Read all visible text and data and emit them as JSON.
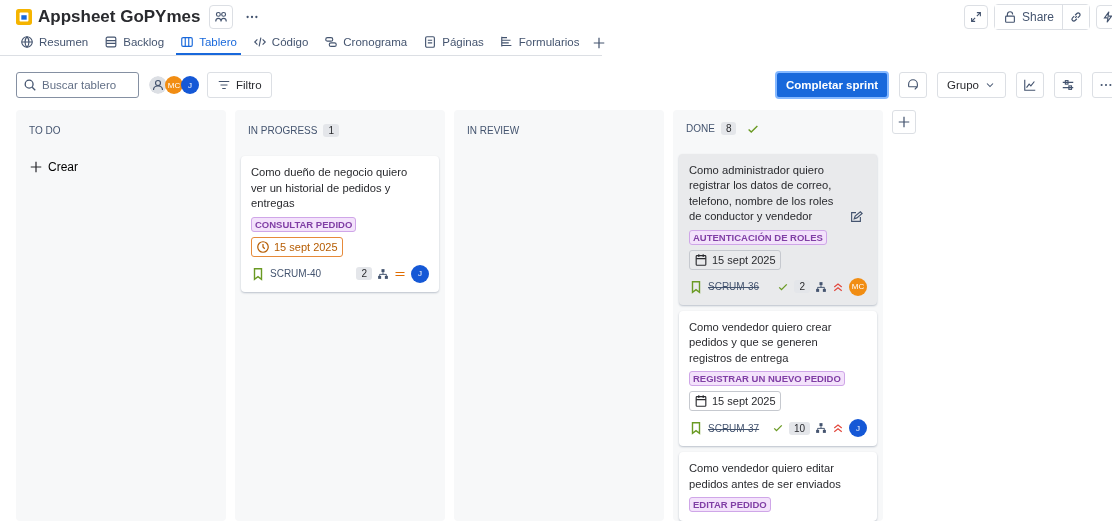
{
  "project": {
    "title": "Appsheet GoPYmes"
  },
  "header_actions": {
    "share": "Share"
  },
  "tabs": [
    {
      "label": "Resumen",
      "selected": false
    },
    {
      "label": "Backlog",
      "selected": false
    },
    {
      "label": "Tablero",
      "selected": true
    },
    {
      "label": "Código",
      "selected": false
    },
    {
      "label": "Cronograma",
      "selected": false
    },
    {
      "label": "Páginas",
      "selected": false
    },
    {
      "label": "Formularios",
      "selected": false
    }
  ],
  "toolbar": {
    "search": {
      "placeholder": "Buscar tablero"
    },
    "avatars": [
      {
        "kind": "unassigned"
      },
      {
        "kind": "person",
        "initials": "MC",
        "color": "#f18d13"
      },
      {
        "kind": "person",
        "initials": "J",
        "color": "#1558d6"
      }
    ],
    "filter": "Filtro",
    "primary": "Completar sprint",
    "group": "Grupo"
  },
  "columns": [
    {
      "title": "TO DO",
      "create": "Crear"
    },
    {
      "title": "IN PROGRESS",
      "count": "1",
      "cards": [
        {
          "text": "Como dueño de negocio quiero ver un historial de pedidos y entregas",
          "selected": false,
          "label": "CONSULTAR PEDIDO",
          "date": {
            "kind": "due",
            "text": "15 sept 2025"
          },
          "key": "SCRUM-40",
          "done": false,
          "points": "2",
          "priority": {
            "kind": "medium"
          },
          "avatar": {
            "initials": "J",
            "color": "#1558d6"
          }
        }
      ]
    },
    {
      "title": "IN REVIEW"
    },
    {
      "title": "DONE",
      "count": "8",
      "complete": true,
      "cards": [
        {
          "text": "Como administrador quiero registrar los datos de correo, telefono, nombre de los roles de conductor y vendedor",
          "selected": true,
          "label": "AUTENTICACIÓN DE ROLES",
          "date": {
            "kind": "date",
            "text": "15 sept 2025"
          },
          "key": "SCRUM-36",
          "done": true,
          "points": "2",
          "priority": {
            "kind": "high"
          },
          "avatar": {
            "initials": "MC",
            "color": "#f18d13"
          }
        },
        {
          "text": "Como vendedor quiero crear pedidos y que se generen registros de entrega",
          "selected": false,
          "label": "REGISTRAR UN NUEVO PEDIDO",
          "date": {
            "kind": "date",
            "text": "15 sept 2025"
          },
          "key": "SCRUM-37",
          "done": true,
          "points": "10",
          "priority": {
            "kind": "high"
          },
          "avatar": {
            "initials": "J",
            "color": "#1558d6"
          }
        },
        {
          "text": "Como vendedor quiero editar pedidos antes de ser enviados",
          "selected": false,
          "label": "EDITAR PEDIDO"
        }
      ]
    }
  ]
}
